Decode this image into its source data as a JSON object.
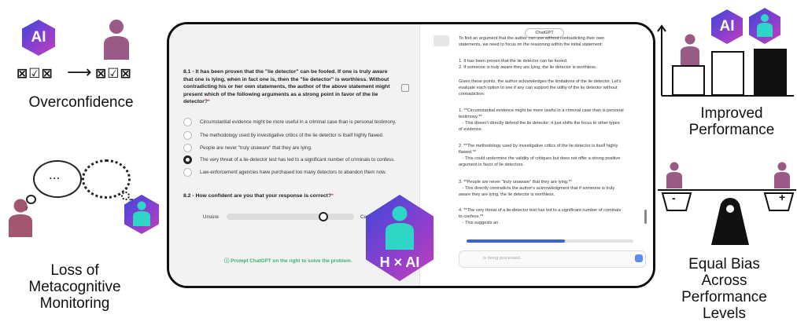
{
  "colors": {
    "hex_gradient_start": "#3b49d8",
    "hex_gradient_end": "#c23fb8",
    "person": "#9a5a86",
    "person_alt": "#a4556f",
    "teal": "#2fd6c5",
    "dark": "#111111"
  },
  "icons": [
    "ai-hex-badge",
    "person-icon",
    "checkbox-icon",
    "arrow-right-icon",
    "thought-bubble-icon",
    "balance-scale-icon",
    "bar-chart-icon"
  ],
  "labels": {
    "ai": "AI",
    "hxai": "H × AI",
    "overconfidence": "Overconfidence",
    "improved_performance": "Improved Performance",
    "loss_monitoring": "Loss of Metacognitive Monitoring",
    "equal_bias": "Equal Bias Across Performance Levels",
    "bubble_dots": "...",
    "checkboxes": "⊠☑⊠",
    "arrow": "⟶",
    "minus": "-",
    "plus": "+"
  },
  "screenshot": {
    "q1": "8.1 - It has been proven that the \"lie detector\" can be fooled. If one is truly aware that one is lying, when in fact one is, then the \"lie detector\" is worthless. Without contradicting his or her own statements, the author of the above statement might present which of the following arguments as a strong point in favor of the lie detector?",
    "req": "*",
    "options": [
      "Circumstantial evidence might be more useful in a criminal case than is personal testimony.",
      "The methodology used by investigative critics of the lie detector is itself highly flawed.",
      "People are never \"truly unaware\" that they are lying.",
      "The very threat of a lie-detector test has led to a significant number of criminals to confess.",
      "Law-enforcement agencies have purchased too many detectors to abandon them now."
    ],
    "q2": "8.2 - How confident are you that your response is correct?",
    "unsure": "Unsure",
    "certain": "Certa",
    "prompt": "ⓘ Prompt ChatGPT on the right to solve the problem.",
    "chatgpt_tab": "ChatGPT",
    "resp_top": "To find an argument that the author can use without contradicting their own\nstatements, we need to focus on the reasoning within the initial statement:",
    "resp_l1": "1. It has been proven that the lie detector can be fooled.",
    "resp_l2": "2. If someone is truly aware they are lying, the lie detector is worthless.",
    "resp_p2": "Given these points, the author acknowledges the limitations of the lie detector. Let's\nevaluate each option to see if any can support the utility of the lie detector without\ncontradiction:",
    "resp_o1": "1. **Circumstantial evidence might be more useful in a criminal case than is personal\ntestimony.**\n   - This doesn't directly defend the lie detector; it just shifts the focus to other types\nof evidence.",
    "resp_o2": "2. **The methodology used by investigative critics of the lie detector is itself highly\nflawed.**\n   - This could undermine the validity of critiques but does not offer a strong positive\nargument in favor of lie detectors.",
    "resp_o3": "3. **People are never \"truly unaware\" that they are lying.**\n   - This directly contradicts the author's acknowledgment that if someone is truly\naware they are lying, the lie detector is worthless.",
    "resp_o4": "4. **The very threat of a lie-detector test has led to a significant number of criminals\nto confess.**\n   - This suggests an",
    "processing": "is being processed..."
  }
}
